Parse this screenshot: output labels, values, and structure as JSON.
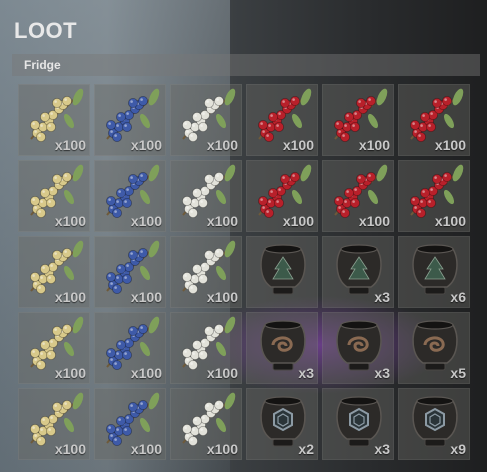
{
  "title": "LOOT",
  "container": {
    "name": "Fridge"
  },
  "colors": {
    "yellow_berry": "#d8c98a",
    "blue_berry": "#3e5aa8",
    "white_berry": "#e2e2da",
    "red_berry": "#b8202a",
    "leaf": "#7fa05a",
    "planter": "#2c2a28"
  },
  "slots": [
    {
      "item": "yellow-berry",
      "qty": "x100"
    },
    {
      "item": "blue-berry",
      "qty": "x100"
    },
    {
      "item": "white-berry",
      "qty": "x100"
    },
    {
      "item": "red-berry",
      "qty": "x100"
    },
    {
      "item": "red-berry",
      "qty": "x100"
    },
    {
      "item": "red-berry",
      "qty": "x100"
    },
    {
      "item": "yellow-berry",
      "qty": "x100"
    },
    {
      "item": "blue-berry",
      "qty": "x100"
    },
    {
      "item": "white-berry",
      "qty": "x100"
    },
    {
      "item": "red-berry",
      "qty": "x100"
    },
    {
      "item": "red-berry",
      "qty": "x100"
    },
    {
      "item": "red-berry",
      "qty": "x100"
    },
    {
      "item": "yellow-berry",
      "qty": "x100"
    },
    {
      "item": "blue-berry",
      "qty": "x100"
    },
    {
      "item": "white-berry",
      "qty": "x100"
    },
    {
      "item": "planter-pot-tree",
      "qty": ""
    },
    {
      "item": "planter-pot-tree",
      "qty": "x3"
    },
    {
      "item": "planter-pot-tree",
      "qty": "x6"
    },
    {
      "item": "yellow-berry",
      "qty": "x100"
    },
    {
      "item": "blue-berry",
      "qty": "x100"
    },
    {
      "item": "white-berry",
      "qty": "x100"
    },
    {
      "item": "planter-pot-swirl",
      "qty": "x3"
    },
    {
      "item": "planter-pot-swirl",
      "qty": "x3"
    },
    {
      "item": "planter-pot-swirl",
      "qty": "x5"
    },
    {
      "item": "yellow-berry",
      "qty": "x100"
    },
    {
      "item": "blue-berry",
      "qty": "x100"
    },
    {
      "item": "white-berry",
      "qty": "x100"
    },
    {
      "item": "planter-pot-hexagon",
      "qty": "x2"
    },
    {
      "item": "planter-pot-hexagon",
      "qty": "x3"
    },
    {
      "item": "planter-pot-hexagon",
      "qty": "x9"
    }
  ]
}
